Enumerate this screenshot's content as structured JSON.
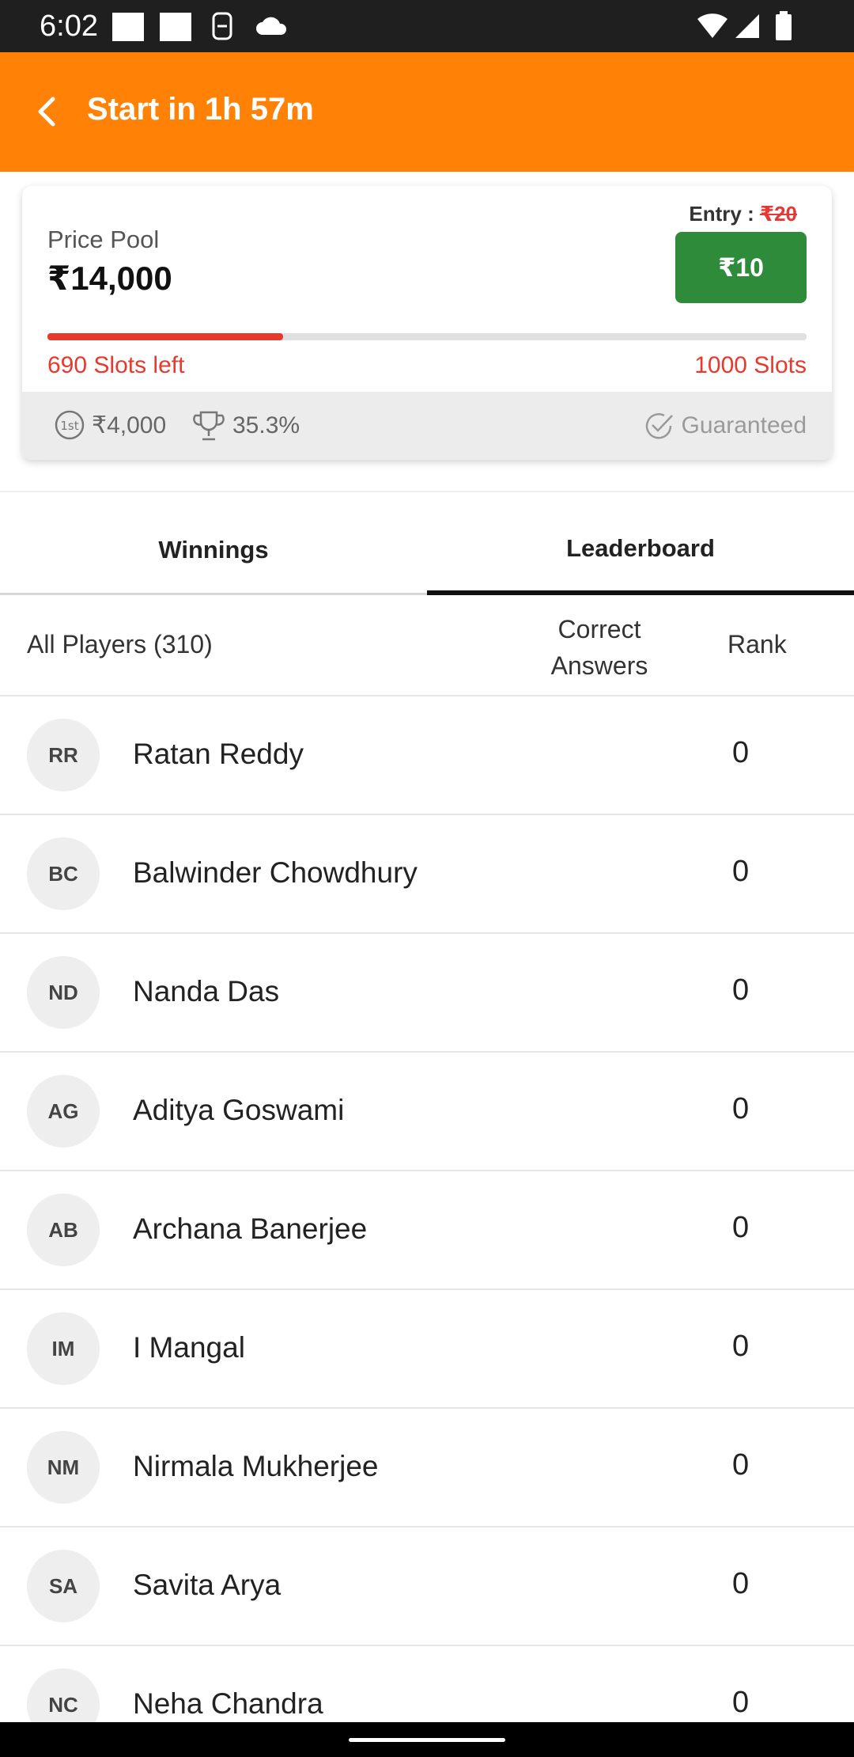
{
  "status_bar": {
    "time": "6:02"
  },
  "app_bar": {
    "title": "Start in 1h 57m"
  },
  "card": {
    "pool_label": "Price Pool",
    "pool_amount": "₹14,000",
    "entry_label": "Entry : ",
    "entry_original": "₹20",
    "entry_price": "₹10",
    "progress_fraction": 0.31,
    "slots_left": "690 Slots left",
    "slots_total": "1000 Slots",
    "first_prize": "₹4,000",
    "win_percent": "35.3%",
    "guaranteed_label": "Guaranteed"
  },
  "tabs": [
    {
      "label": "Winnings",
      "active": false
    },
    {
      "label": "Leaderboard",
      "active": true
    }
  ],
  "table": {
    "players_header": "All Players (310)",
    "correct_header": "Correct Answers",
    "rank_header": "Rank",
    "rows": [
      {
        "initials": "RR",
        "name": "Ratan Reddy",
        "rank": "0"
      },
      {
        "initials": "BC",
        "name": "Balwinder Chowdhury",
        "rank": "0"
      },
      {
        "initials": "ND",
        "name": "Nanda Das",
        "rank": "0"
      },
      {
        "initials": "AG",
        "name": "Aditya Goswami",
        "rank": "0"
      },
      {
        "initials": "AB",
        "name": "Archana Banerjee",
        "rank": "0"
      },
      {
        "initials": "IM",
        "name": "I Mangal",
        "rank": "0"
      },
      {
        "initials": "NM",
        "name": "Nirmala Mukherjee",
        "rank": "0"
      },
      {
        "initials": "SA",
        "name": "Savita Arya",
        "rank": "0"
      },
      {
        "initials": "NC",
        "name": "Neha Chandra",
        "rank": "0"
      }
    ]
  },
  "colors": {
    "app_bar": "#ff8206",
    "entry_button": "#2e8b39",
    "progress": "#e8392e"
  },
  "icons": [
    "back-arrow-icon",
    "first-prize-icon",
    "trophy-icon",
    "check-circle-icon",
    "wifi-icon",
    "signal-icon",
    "battery-icon",
    "cloud-icon"
  ]
}
